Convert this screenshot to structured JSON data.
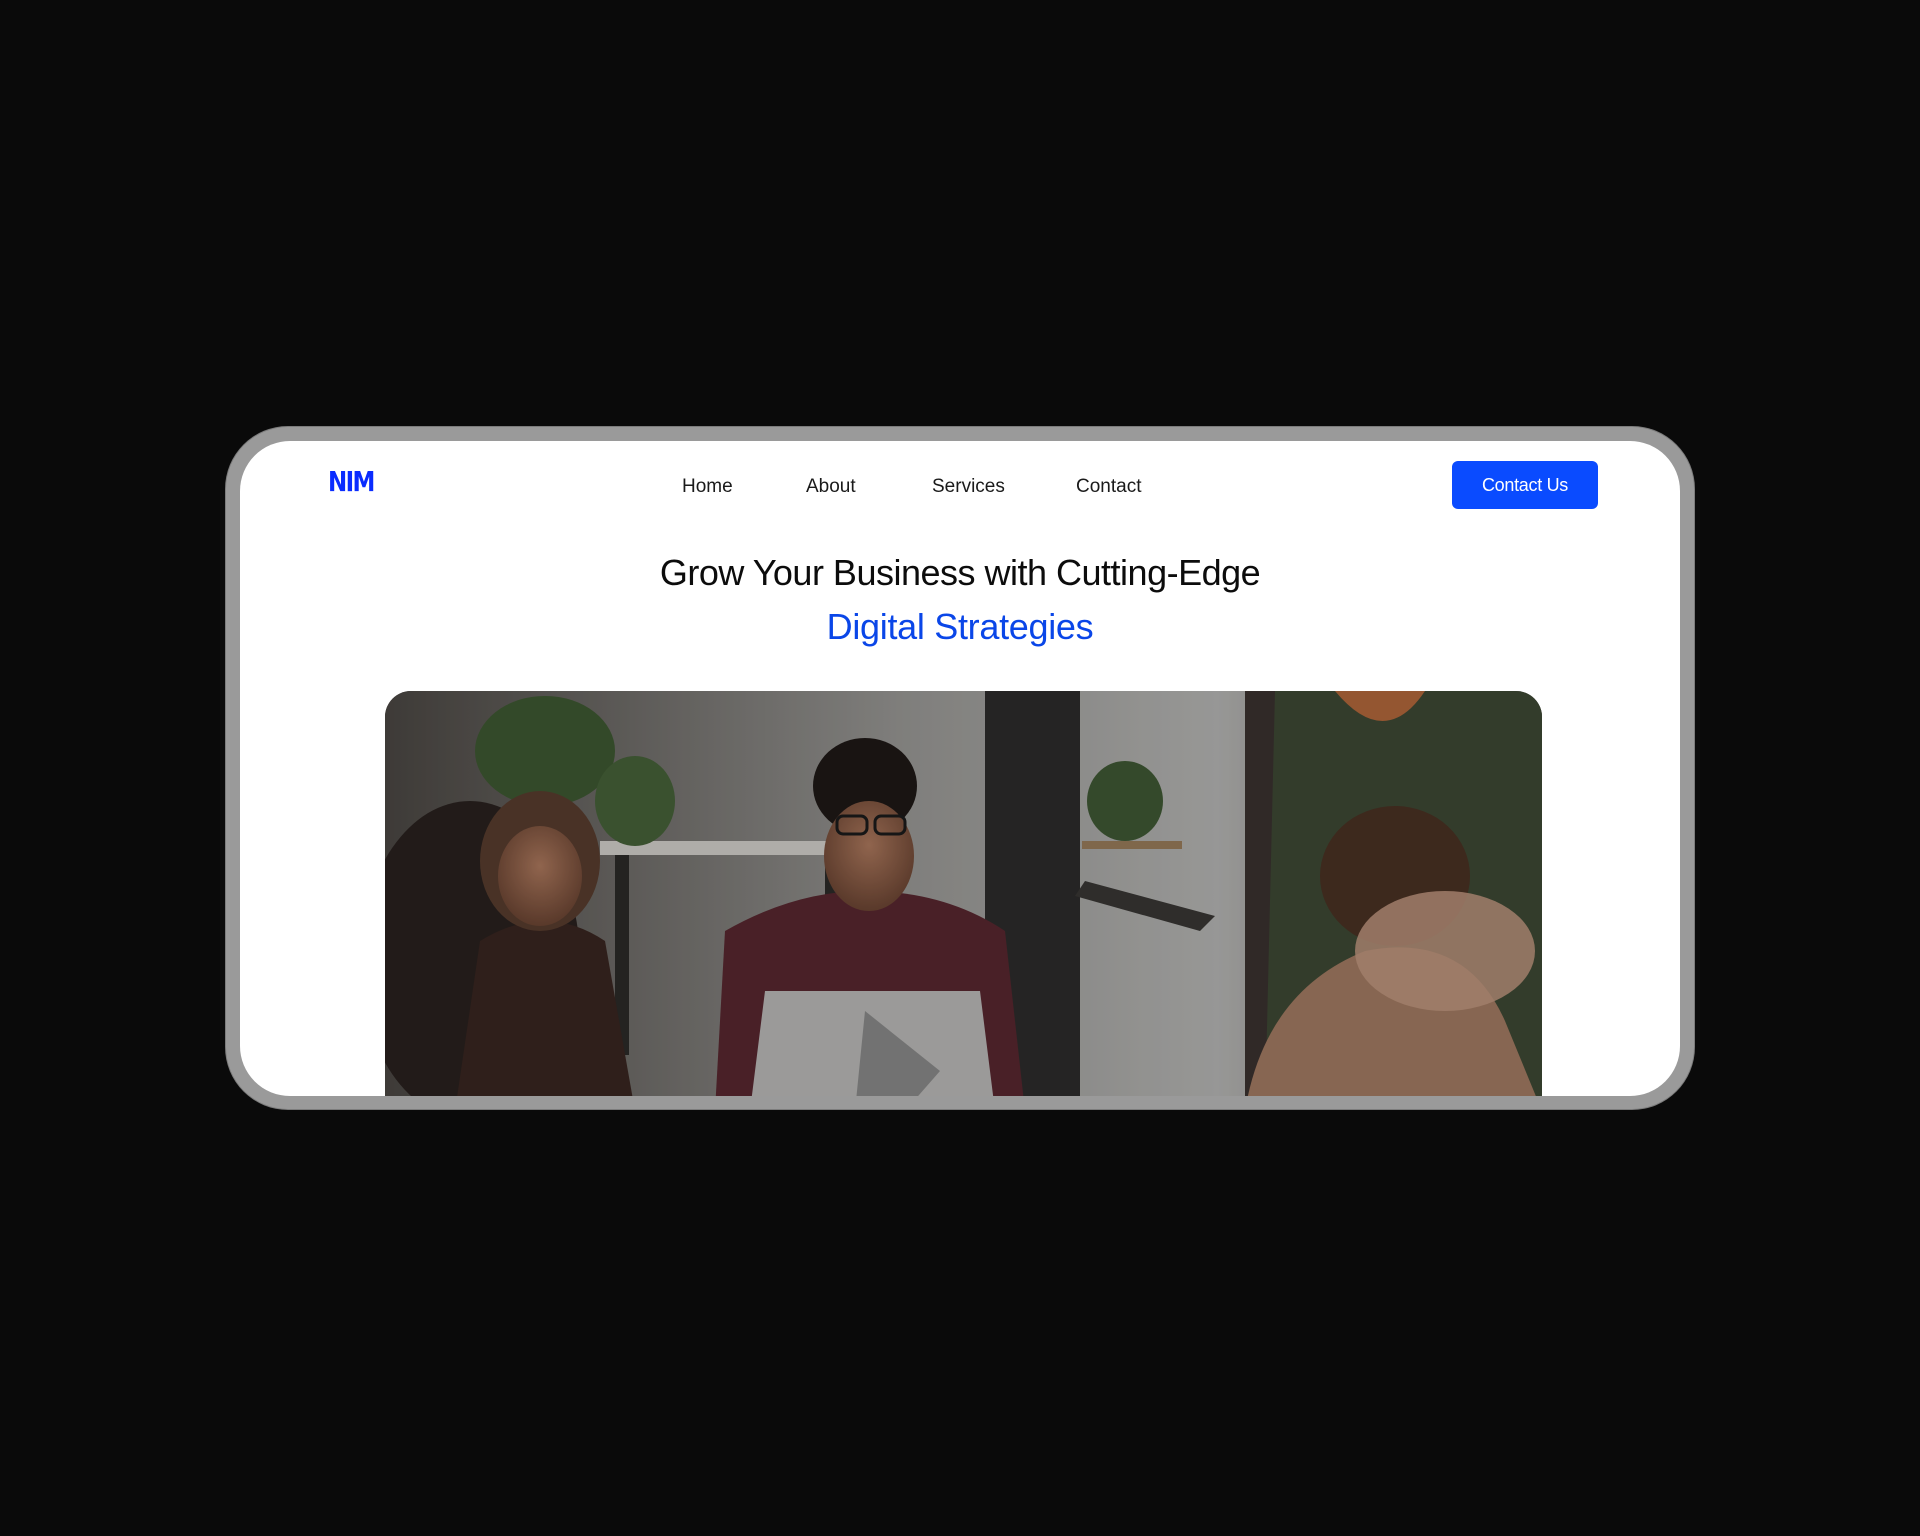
{
  "brand": {
    "logo_text": "NIM",
    "accent_color": "#0a4bff"
  },
  "nav": {
    "links": [
      {
        "label": "Home"
      },
      {
        "label": "About"
      },
      {
        "label": "Services"
      },
      {
        "label": "Contact"
      }
    ],
    "cta_label": "Contact Us"
  },
  "hero": {
    "title_line1": "Grow Your Business with Cutting-Edge",
    "title_line2": "Digital Strategies",
    "title_color": "#0c0c0c",
    "highlight_color": "#0a46e8",
    "image_icon": "team-meeting-photo"
  },
  "colors": {
    "page_background": "#0a0a0a",
    "frame": "#9a9a9a",
    "screen": "#ffffff"
  }
}
